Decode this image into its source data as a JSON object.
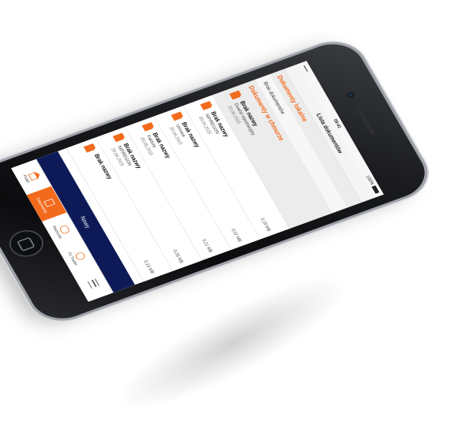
{
  "status_bar": {
    "carrier": "•••••",
    "time": "09:41",
    "battery": "100%"
  },
  "navbar": {
    "title": "Lista dokumentów"
  },
  "local_section": {
    "title": "Dokumenty lokalne",
    "empty_text": "Brak dokumentów"
  },
  "cloud_section": {
    "title": "Dokumenty w chmurze",
    "documents": [
      {
        "name": "Brak nazwy",
        "type": "Dowód rejestracyjny",
        "date": "20.04.2015",
        "size": ""
      },
      {
        "name": "Brak nazwy",
        "type": "NIP/REGON",
        "date": "30.04.2015",
        "size": "0,18 MB"
      },
      {
        "name": "Brak nazwy",
        "type": "Umowa",
        "date": "29.04.2015",
        "size": "0,02 MB"
      },
      {
        "name": "Brak nazwy",
        "type": "Faktura",
        "date": "05.05.2015",
        "size": "0,21 MB"
      },
      {
        "name": "Brak nazwy",
        "type": "NIP/REGON",
        "date": "29.04.2015",
        "size": "0,35 MB"
      },
      {
        "name": "Brak nazwy",
        "type": "",
        "date": "",
        "size": "0,19 MB"
      }
    ]
  },
  "new_button": {
    "label": "Nowy"
  },
  "tabbar": {
    "items": [
      {
        "label": "Pulpit",
        "icon": "home-icon"
      },
      {
        "label": "Dokumenty",
        "icon": "documents-icon"
      },
      {
        "label": "Rachunki",
        "icon": "coins-icon"
      },
      {
        "label": "Fx Trader",
        "icon": "fx-icon"
      },
      {
        "label": "",
        "icon": "menu-icon"
      }
    ]
  },
  "colors": {
    "accent": "#f26b1d",
    "new_bar": "#0d1a57"
  }
}
